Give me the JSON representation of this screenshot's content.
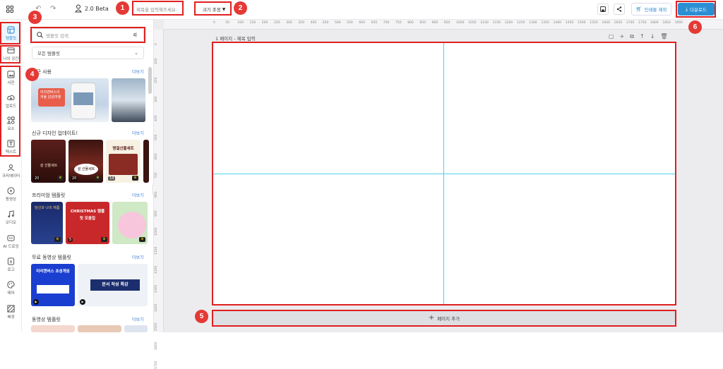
{
  "topbar": {
    "version": "2.0 Beta",
    "title_placeholder": "제목을 입력해주세요.",
    "size_label": "크기 조정",
    "print_label": "인쇄물 제작",
    "download_label": "다운로드"
  },
  "sidebar": {
    "items": [
      {
        "label": "템플릿",
        "icon": "template-icon"
      },
      {
        "label": "나의 공간",
        "icon": "folder-icon"
      },
      {
        "label": "사진",
        "icon": "photo-icon"
      },
      {
        "label": "업로드",
        "icon": "upload-icon"
      },
      {
        "label": "요소",
        "icon": "elements-icon"
      },
      {
        "label": "텍스트",
        "icon": "text-icon"
      },
      {
        "label": "크리에이터",
        "icon": "creator-icon"
      },
      {
        "label": "동영상",
        "icon": "video-icon"
      },
      {
        "label": "오디오",
        "icon": "audio-icon"
      },
      {
        "label": "AI 드로잉",
        "icon": "ai-drawing-icon"
      },
      {
        "label": "로고",
        "icon": "logo-icon"
      },
      {
        "label": "테마",
        "icon": "theme-icon"
      },
      {
        "label": "배경",
        "icon": "background-icon"
      }
    ]
  },
  "panel": {
    "search_placeholder": "템플릿 검색",
    "filter_label": "모든 템플릿",
    "more_label": "더보기",
    "sections": [
      {
        "title": "최근 사용"
      },
      {
        "title": "신규 디자인 업데이트!"
      },
      {
        "title": "프리미엄 템플릿"
      },
      {
        "title": "무료 동영상 템플릿"
      },
      {
        "title": "동영상 템플릿"
      }
    ],
    "recent_thumb_text": "미리캔버스의 겨울 감성여행",
    "new_thumbs": [
      {
        "text": "설 선물세트",
        "count": "20"
      },
      {
        "text": "설 선물세트",
        "count": "20"
      },
      {
        "text": "명절선물세트",
        "count": "14"
      }
    ],
    "premium_thumbs": [
      {
        "text": "당신과 나의 여름",
        "count": ""
      },
      {
        "text": "CHRISTMAS 템플릿 모음집",
        "count": "5"
      },
      {
        "text": "",
        "count": ""
      }
    ],
    "free_video_thumbs": [
      {
        "text": "미리캔버스 초성게임"
      },
      {
        "text": "문서 작성 특강"
      }
    ]
  },
  "canvas": {
    "page_label": "1 페이지 - 제목 입력",
    "add_page_label": "페이지 추가",
    "ruler_h": [
      "0",
      "50",
      "100",
      "150",
      "200",
      "250",
      "300",
      "350",
      "400",
      "450",
      "500",
      "550",
      "600",
      "650",
      "700",
      "750",
      "800",
      "850",
      "900",
      "950",
      "1000",
      "1050",
      "1100",
      "1150",
      "1200",
      "1250",
      "1300",
      "1350",
      "1400",
      "1450",
      "1500",
      "1550",
      "1600",
      "1650",
      "1700",
      "1750",
      "1800",
      "1850",
      "1900"
    ],
    "ruler_v": [
      "0",
      "100",
      "200",
      "300",
      "400",
      "500",
      "600",
      "700",
      "800",
      "900",
      "1000",
      "1100",
      "1200",
      "1300",
      "1400",
      "1500",
      "1600",
      "1700"
    ]
  },
  "annotations": {
    "badges": [
      "1",
      "2",
      "3",
      "4",
      "5",
      "6"
    ]
  },
  "colors": {
    "accent": "#2b8fd4",
    "annotation_red": "#e02020",
    "guide": "#4fd3e6"
  }
}
